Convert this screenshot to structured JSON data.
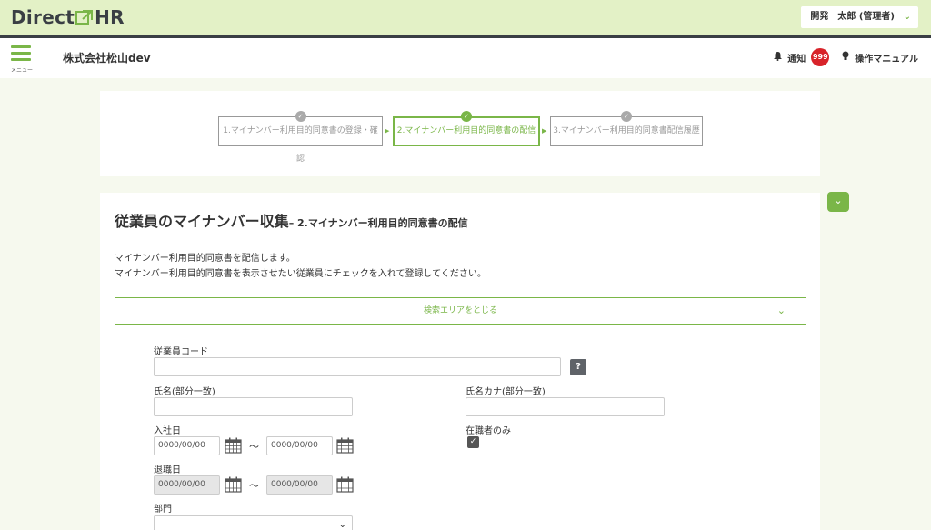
{
  "app": {
    "logo_left": "Direct",
    "logo_right": "HR",
    "user_label": "開発　太郎 (管理者)"
  },
  "header": {
    "menu_label": "メニュー",
    "company": "株式会社松山dev",
    "notify_label": "通知",
    "notify_count": "999",
    "manual_label": "操作マニュアル"
  },
  "steps": [
    {
      "label": "1.マイナンバー利用目的同意書の登録・確認",
      "active": false
    },
    {
      "label": "2.マイナンバー利用目的同意書の配信",
      "active": true
    },
    {
      "label": "3.マイナンバー利用目的同意書配信履歴",
      "active": false
    }
  ],
  "main": {
    "title": "従業員のマイナンバー収集",
    "subtitle": "– 2.マイナンバー利用目的同意書の配信",
    "desc1": "マイナンバー利用目的同意書を配信します。",
    "desc2": "マイナンバー利用目的同意書を表示させたい従業員にチェックを入れて登録してください。"
  },
  "search": {
    "toggle_label": "検索エリアをとじる",
    "employee_code_label": "従業員コード",
    "employee_code_value": "",
    "help_label": "?",
    "name_label": "氏名(部分一致)",
    "name_value": "",
    "kana_label": "氏名カナ(部分一致)",
    "kana_value": "",
    "hire_date_label": "入社日",
    "hire_from_placeholder": "0000/00/00",
    "hire_to_placeholder": "0000/00/00",
    "active_only_label": "在職者のみ",
    "active_only_checked": true,
    "retire_date_label": "退職日",
    "retire_from_placeholder": "0000/00/00",
    "retire_to_placeholder": "0000/00/00",
    "range_sep": "～",
    "dept_label": "部門",
    "dept_value": ""
  },
  "colors": {
    "accent": "#7ab648",
    "topbar_bg": "#e3f1c6",
    "badge": "#d8232a"
  }
}
